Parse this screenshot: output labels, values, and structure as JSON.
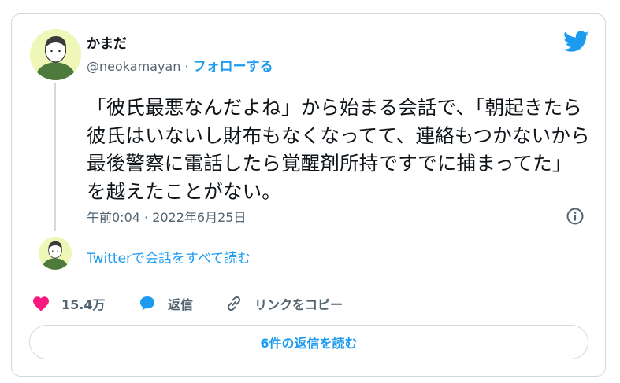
{
  "author": {
    "name": "かまだ",
    "handle": "@neokamayan",
    "separator": " · ",
    "follow_label": "フォローする"
  },
  "tweet": {
    "text": "「彼氏最悪なんだよね」から始まる会話で、「朝起きたら彼氏はいないし財布もなくなってて、連絡もつかないから最後警察に電話したら覚醒剤所持ですでに捕まってた」を越えたことがない。",
    "timestamp": "午前0:04 · 2022年6月25日"
  },
  "conversation_link": "Twitterで会話をすべて読む",
  "actions": {
    "like_count": "15.4万",
    "reply_label": "返信",
    "copy_link_label": "リンクをコピー"
  },
  "replies_button": "6件の返信を読む",
  "colors": {
    "accent": "#1d9bf0",
    "like": "#f91880",
    "muted": "#536471",
    "avatar_bg": "#eef7b8",
    "avatar_shirt": "#4f7a3e"
  },
  "icons": [
    "twitter-bird-icon",
    "info-icon",
    "heart-icon",
    "reply-bubble-icon",
    "link-icon"
  ]
}
